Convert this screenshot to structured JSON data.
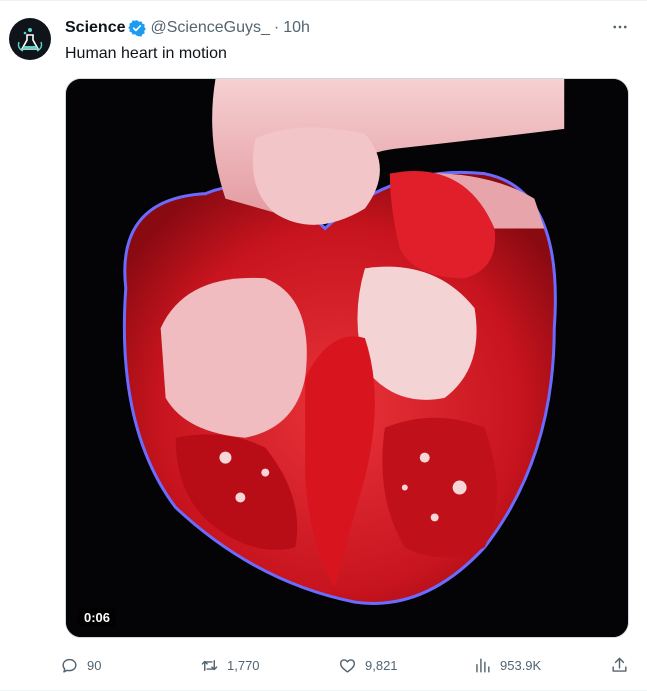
{
  "tweet": {
    "author_name": "Science",
    "handle": "@ScienceGuys_",
    "separator": "·",
    "time": "10h",
    "text": "Human heart in motion",
    "video_duration": "0:06",
    "accent_color": "#1d9bf0",
    "actions": {
      "replies": "90",
      "retweets": "1,770",
      "likes": "9,821",
      "views": "953.9K"
    },
    "icons": [
      "verified-badge-icon",
      "more-icon",
      "reply-icon",
      "retweet-icon",
      "like-icon",
      "views-icon",
      "share-icon"
    ]
  }
}
